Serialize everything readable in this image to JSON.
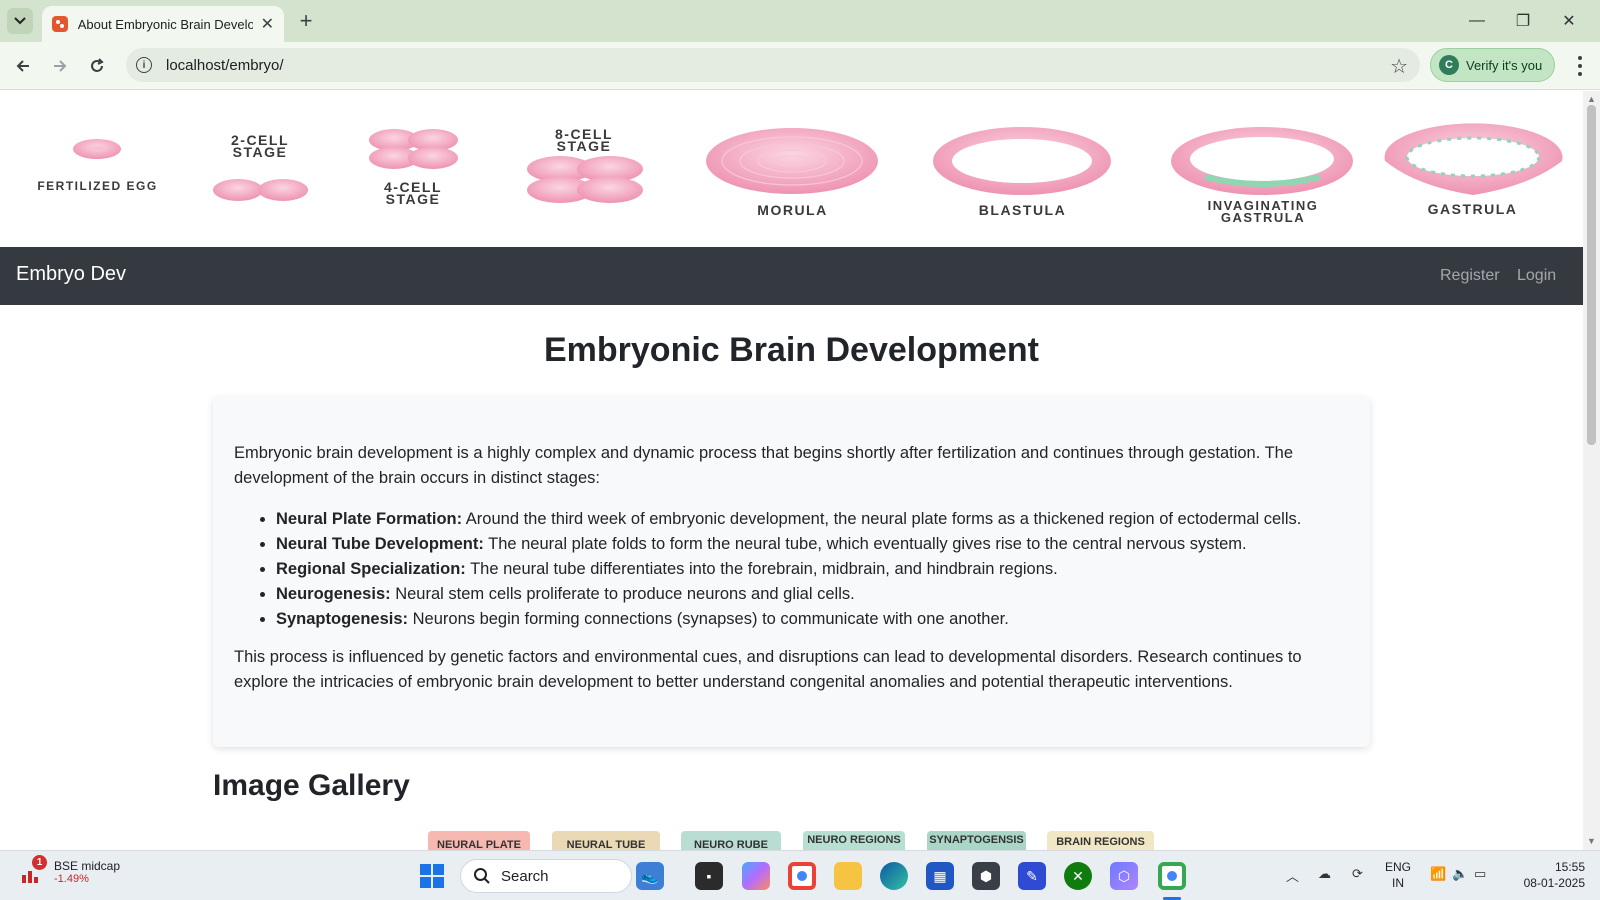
{
  "browser": {
    "tab_title": "About Embryonic Brain Development",
    "url": "localhost/embryo/",
    "verify_label": "Verify it's you",
    "verify_avatar": "C"
  },
  "banner": {
    "stages": [
      "FERTILIZED EGG",
      "2-CELL STAGE",
      "4-CELL STAGE",
      "8-CELL STAGE",
      "MORULA",
      "BLASTULA",
      "INVAGINATING GASTRULA",
      "GASTRULA"
    ]
  },
  "navbar": {
    "brand": "Embryo Dev",
    "links": [
      "Register",
      "Login"
    ]
  },
  "main": {
    "title": "Embryonic Brain Development",
    "intro": "Embryonic brain development is a highly complex and dynamic process that begins shortly after fertilization and continues through gestation. The development of the brain occurs in distinct stages:",
    "stages": [
      {
        "term": "Neural Plate Formation:",
        "text": " Around the third week of embryonic development, the neural plate forms as a thickened region of ectodermal cells."
      },
      {
        "term": "Neural Tube Development:",
        "text": " The neural plate folds to form the neural tube, which eventually gives rise to the central nervous system."
      },
      {
        "term": "Regional Specialization:",
        "text": " The neural tube differentiates into the forebrain, midbrain, and hindbrain regions."
      },
      {
        "term": "Neurogenesis:",
        "text": " Neural stem cells proliferate to produce neurons and glial cells."
      },
      {
        "term": "Synaptogenesis:",
        "text": " Neurons begin forming connections (synapses) to communicate with one another."
      }
    ],
    "outro": "This process is influenced by genetic factors and environmental cues, and disruptions can lead to developmental disorders. Research continues to explore the intricacies of embryonic brain development to better understand congenital anomalies and potential therapeutic interventions.",
    "gallery_title": "Image Gallery",
    "gallery_thumbs": [
      "NEURAL PLATE",
      "NEURAL TUBE",
      "NEURO RUBE",
      "NEURO REGIONS",
      "SYNAPTOGENSIS",
      "BRAIN REGIONS"
    ]
  },
  "taskbar": {
    "stock_name": "BSE midcap",
    "stock_change": "-1.49%",
    "stock_badge": "1",
    "search_label": "Search",
    "lang_line1": "ENG",
    "lang_line2": "IN",
    "time": "15:55",
    "date": "08-01-2025"
  },
  "colors": {
    "titlebar": "#d3e3cd",
    "navbar": "#343a40",
    "card": "#f8f9fa",
    "embryo_pink": "#f2a4bd",
    "gastrula_green": "#8fd6b3"
  }
}
